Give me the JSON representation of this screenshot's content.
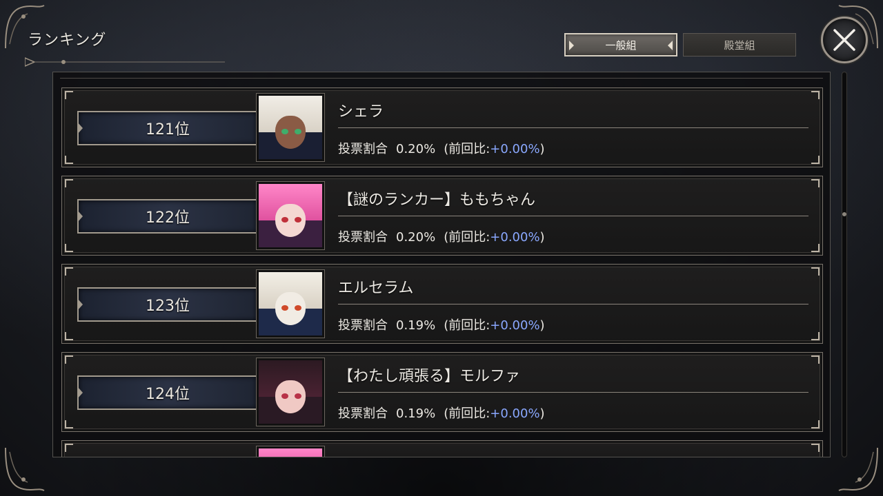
{
  "screen": {
    "title": "ランキング"
  },
  "tabs": [
    {
      "label": "一般組",
      "active": true
    },
    {
      "label": "殿堂組",
      "active": false
    }
  ],
  "close_button": {
    "icon": "close-icon"
  },
  "rankings": [
    {
      "rank": "121位",
      "name": "シェラ",
      "label": "投票割合",
      "share": "0.20%",
      "prev_prefix": "(前回比:",
      "delta": "+0.00%",
      "prev_suffix": ")"
    },
    {
      "rank": "122位",
      "name": "【謎のランカー】ももちゃん",
      "label": "投票割合",
      "share": "0.20%",
      "prev_prefix": "(前回比:",
      "delta": "+0.00%",
      "prev_suffix": ")"
    },
    {
      "rank": "123位",
      "name": "エルセラム",
      "label": "投票割合",
      "share": "0.19%",
      "prev_prefix": "(前回比:",
      "delta": "+0.00%",
      "prev_suffix": ")"
    },
    {
      "rank": "124位",
      "name": "【わたし頑張る】モルファ",
      "label": "投票割合",
      "share": "0.19%",
      "prev_prefix": "(前回比:",
      "delta": "+0.00%",
      "prev_suffix": ")"
    }
  ],
  "colors": {
    "delta": "#8aa8ff",
    "frame": "#a39b8e",
    "panel": "#121214"
  }
}
